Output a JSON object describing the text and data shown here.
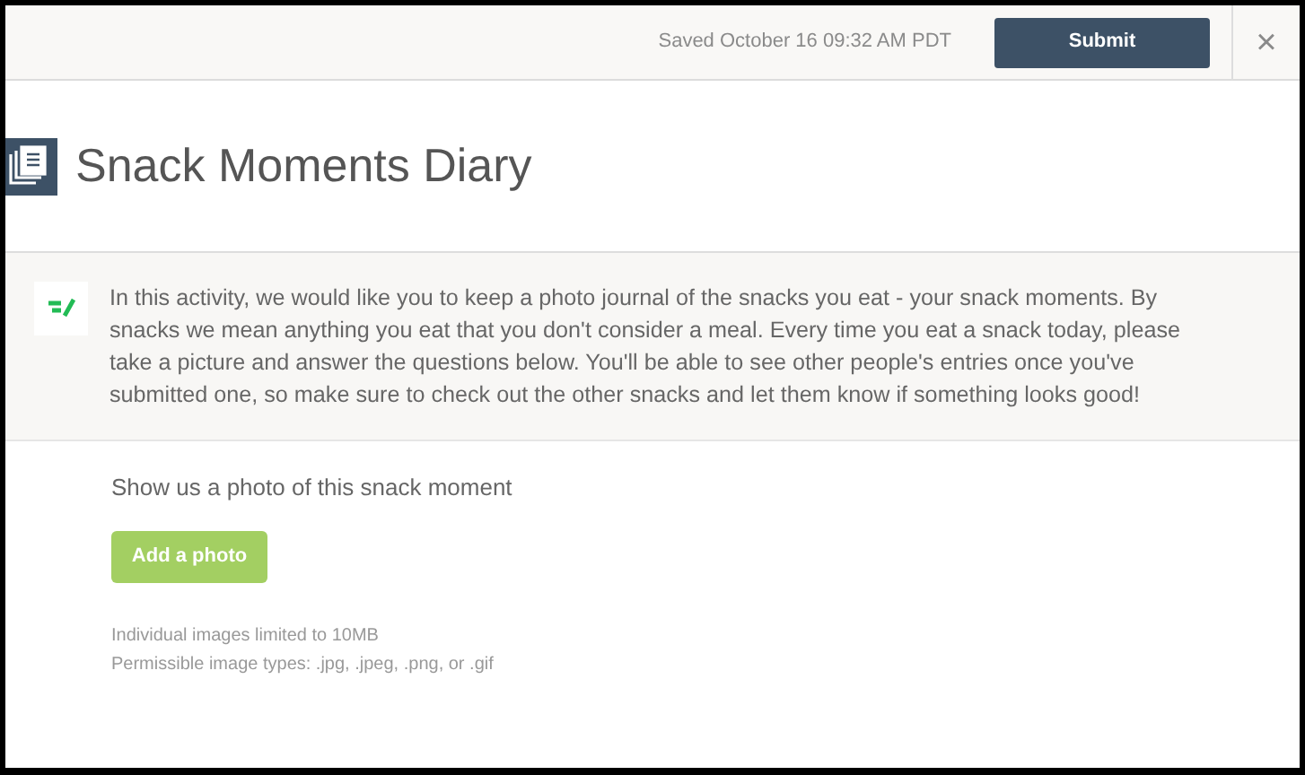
{
  "header": {
    "saved_status": "Saved October 16 09:32 AM PDT",
    "submit_label": "Submit",
    "close_label": "×"
  },
  "title": "Snack Moments Diary",
  "intro": "In this activity, we would like you to keep a photo journal of the snacks you eat - your snack moments. By snacks we mean anything you eat that you don't consider a meal. Every time you eat a snack today, please take a picture and answer the questions below. You'll be able to see other people's entries once you've submitted one, so make sure to check out the other snacks and let them know if something looks good!",
  "question": {
    "prompt": "Show us a photo of this snack moment",
    "button_label": "Add a photo",
    "notes": [
      "Individual images limited to 10MB",
      "Permissible image types: .jpg, .jpeg, .png, or .gif"
    ]
  }
}
